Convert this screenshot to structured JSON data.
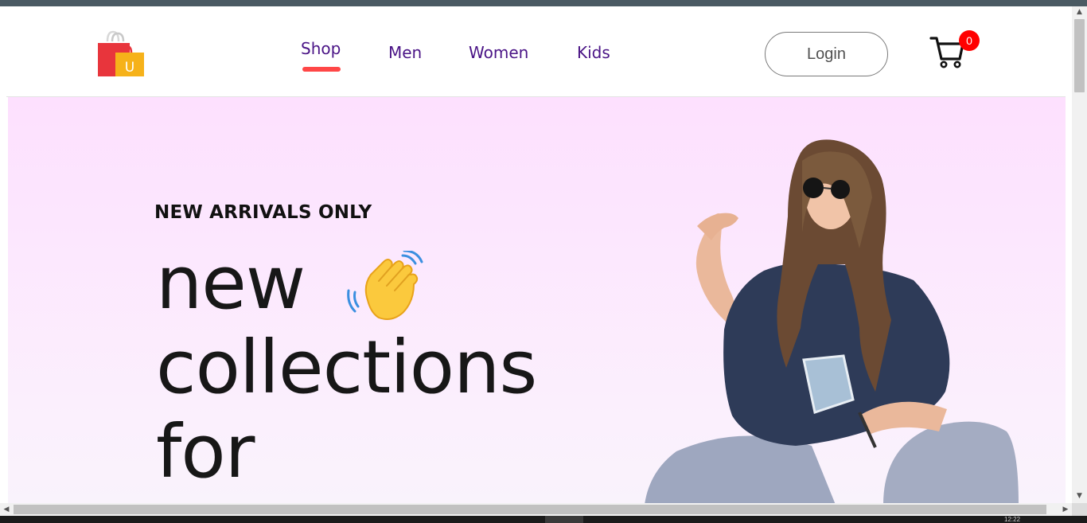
{
  "nav": {
    "links": [
      "Shop",
      "Men",
      "Women",
      "Kids"
    ],
    "active": "Shop",
    "login_label": "Login",
    "cart_count": "0",
    "logo_letter": "U",
    "logo_icon": "shopping-bags-icon",
    "cart_icon": "shopping-cart-icon"
  },
  "hero": {
    "eyebrow": "NEW ARRIVALS ONLY",
    "headline": [
      "new",
      "collections",
      "for"
    ],
    "emoji": "waving-hand-icon",
    "image": "model-photo"
  },
  "colors": {
    "nav_link": "#4a1486",
    "active_underline": "#ff4747",
    "badge": "#ff0000",
    "hero_bg_top": "#fde0fe",
    "hero_bg_bottom": "#f9f3fc"
  },
  "taskbar": {
    "clock": "12:22"
  }
}
